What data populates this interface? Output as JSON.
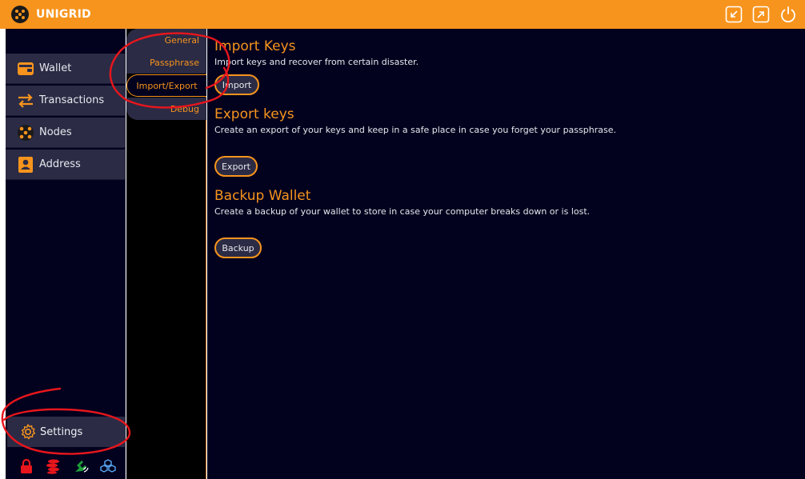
{
  "app": {
    "brand": "UNIGRID",
    "window_buttons": [
      {
        "name": "minimize-window-icon"
      },
      {
        "name": "maximize-window-icon"
      },
      {
        "name": "power-icon"
      }
    ]
  },
  "sidebar": {
    "items": [
      {
        "label": "Wallet",
        "icon": "wallet-icon"
      },
      {
        "label": "Transactions",
        "icon": "transfer-arrows-icon"
      },
      {
        "label": "Nodes",
        "icon": "nodes-icon"
      },
      {
        "label": "Address",
        "icon": "address-book-icon"
      }
    ],
    "settings_label": "Settings",
    "status_icons": [
      "lock-icon",
      "coins-icon",
      "network-signal-icon",
      "cubes-icon"
    ]
  },
  "subtabs": [
    {
      "label": "General"
    },
    {
      "label": "Passphrase"
    },
    {
      "label": "Import/Export",
      "active": true
    },
    {
      "label": "Debug"
    }
  ],
  "content": {
    "import": {
      "title": "Import Keys",
      "description": "Import keys and recover from certain disaster.",
      "button": "Import"
    },
    "export": {
      "title": "Export keys",
      "description": "Create an export of your keys and keep in a safe place in case you forget your passphrase.",
      "button": "Export"
    },
    "backup": {
      "title": "Backup Wallet",
      "description": "Create a backup of your wallet to store in case your computer breaks down or is lost.",
      "button": "Backup"
    }
  },
  "colors": {
    "accent": "#f7941d",
    "background": "#02021e",
    "panel": "#2b2b45",
    "annotation": "#e8161c"
  }
}
